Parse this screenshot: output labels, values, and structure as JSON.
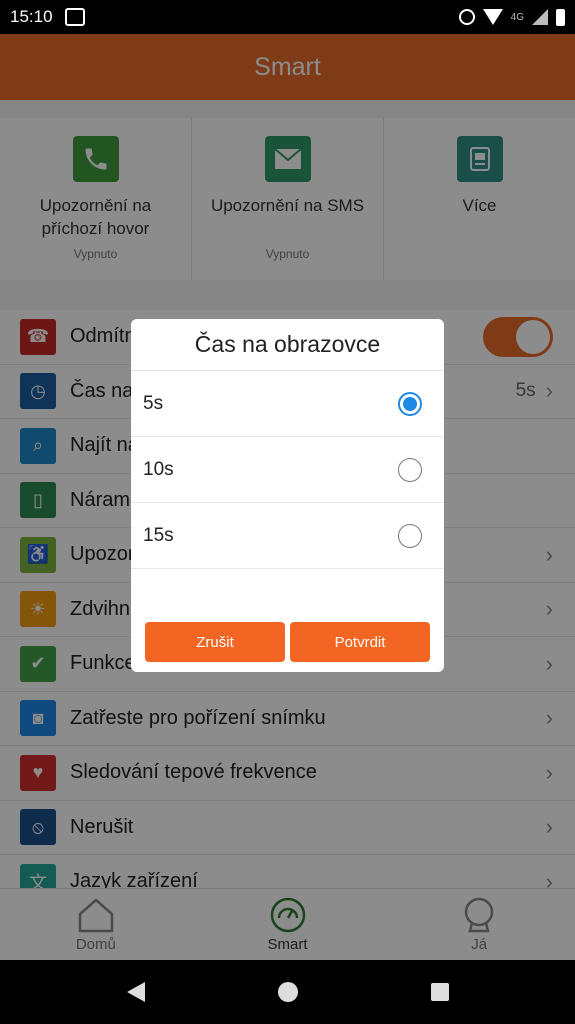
{
  "status_bar": {
    "time": "15:10",
    "network": "4G"
  },
  "app_bar": {
    "title": "Smart"
  },
  "quick_cards": [
    {
      "label": "Upozornění na příchozí hovor",
      "status": "Vypnuto",
      "icon": "phone-icon",
      "color": "#3f9b3f"
    },
    {
      "label": "Upozornění na SMS",
      "status": "Vypnuto",
      "icon": "envelope-icon",
      "color": "#2e9a6a"
    },
    {
      "label": "Více",
      "status": "",
      "icon": "app-icon",
      "color": "#2f8f86"
    }
  ],
  "settings": [
    {
      "label": "Odmítnout hovor",
      "color": "#c62828",
      "icon": "hangup-icon",
      "glyph": "☎"
    },
    {
      "label": "Čas na obrazovce",
      "value": "5s",
      "color": "#1e5f9e",
      "icon": "clock-icon",
      "glyph": "◷"
    },
    {
      "label": "Najít náramek",
      "color": "#1e88c8",
      "icon": "search-icon",
      "glyph": "⌕"
    },
    {
      "label": "Náramek",
      "color": "#2e8b57",
      "icon": "band-icon",
      "glyph": "▯"
    },
    {
      "label": "Upozornění na sedavý režim",
      "color": "#7cb342",
      "icon": "sitting-icon",
      "glyph": "♿"
    },
    {
      "label": "Zdvihnutí zápěstí",
      "color": "#f39c12",
      "icon": "sun-icon",
      "glyph": "☀"
    },
    {
      "label": "Funkce",
      "color": "#43a047",
      "icon": "shield-icon",
      "glyph": "✔"
    },
    {
      "label": "Zatřeste pro pořízení snímku",
      "color": "#1e88e5",
      "icon": "camera-icon",
      "glyph": "◙"
    },
    {
      "label": "Sledování tepové frekvence",
      "color": "#d32f2f",
      "icon": "heart-rate-icon",
      "glyph": "♥"
    },
    {
      "label": "Nerušit",
      "color": "#1a4f8b",
      "icon": "block-icon",
      "glyph": "⦸"
    },
    {
      "label": "Jazyk zařízení",
      "color": "#26a69a",
      "icon": "language-icon",
      "glyph": "文"
    }
  ],
  "dialog": {
    "title": "Čas na obrazovce",
    "options": [
      {
        "label": "5s",
        "selected": true
      },
      {
        "label": "10s",
        "selected": false
      },
      {
        "label": "15s",
        "selected": false
      }
    ],
    "cancel": "Zrušit",
    "confirm": "Potvrdit",
    "button_color": "#f26522",
    "radio_color": "#1e88e5"
  },
  "bottom_nav": [
    {
      "label": "Domů",
      "icon": "home-icon",
      "active": false
    },
    {
      "label": "Smart",
      "icon": "smart-icon",
      "active": true
    },
    {
      "label": "Já",
      "icon": "profile-icon",
      "active": false
    }
  ],
  "accent": "#e76a2a"
}
